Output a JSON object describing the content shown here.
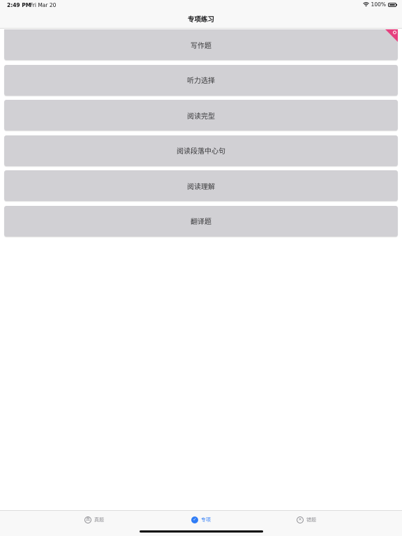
{
  "status_bar": {
    "time": "2:49 PM",
    "date": "Fri Mar 20",
    "battery": "100%",
    "battery_level": 1.0
  },
  "nav": {
    "title": "专项练习"
  },
  "items": [
    {
      "label": "写作题"
    },
    {
      "label": "听力选择"
    },
    {
      "label": "阅读完型"
    },
    {
      "label": "阅读段落中心句"
    },
    {
      "label": "阅读理解"
    },
    {
      "label": "翻译题"
    }
  ],
  "colors": {
    "item_bg": "#d1d0d4",
    "accent": "#2f7cf6",
    "ribbon": "#e6407f"
  },
  "tabs": [
    {
      "label": "真题",
      "icon": "zhen-icon",
      "glyph": "真",
      "active": false
    },
    {
      "label": "专项",
      "icon": "compass-icon",
      "glyph": "✓",
      "active": true
    },
    {
      "label": "错题",
      "icon": "close-icon",
      "glyph": "✕",
      "active": false
    }
  ]
}
